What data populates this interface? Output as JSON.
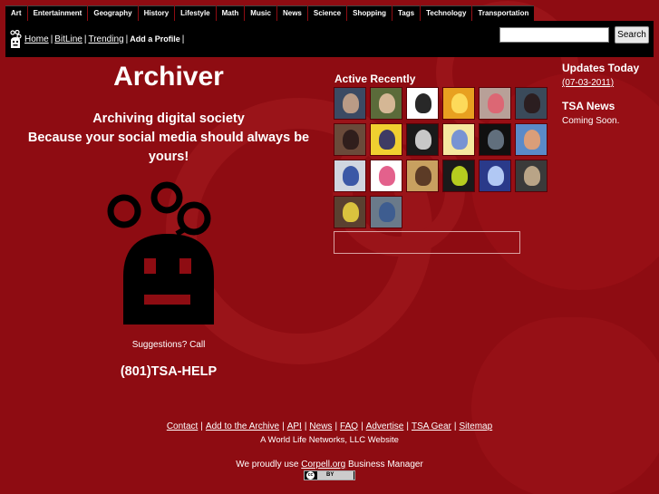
{
  "nav": {
    "categories": [
      "Art",
      "Entertainment",
      "Geography",
      "History",
      "Lifestyle",
      "Math",
      "Music",
      "News",
      "Science",
      "Shopping",
      "Tags",
      "Technology",
      "Transportation"
    ]
  },
  "topbar": {
    "home": "Home",
    "bitline": "BitLine",
    "trending": "Trending",
    "add_profile": "Add a Profile",
    "search_button": "Search",
    "search_value": ""
  },
  "main": {
    "title": "Archiver",
    "tagline_1": "Archiving digital society",
    "tagline_2": "Because your social media should always be yours!",
    "suggestions": "Suggestions? Call",
    "phone": "(801)TSA-HELP"
  },
  "active": {
    "heading": "Active Recently",
    "avatars": [
      {
        "bg": "#3b4a63",
        "fg": "#c9a48a"
      },
      {
        "bg": "#5b6b3a",
        "fg": "#e2c0a0"
      },
      {
        "bg": "#ffffff",
        "fg": "#111111"
      },
      {
        "bg": "#e8a020",
        "fg": "#ffe060"
      },
      {
        "bg": "#b8a098",
        "fg": "#e06070"
      },
      {
        "bg": "#3a4a5a",
        "fg": "#2a1a1a"
      },
      {
        "bg": "#6a4a3a",
        "fg": "#2a1a1a"
      },
      {
        "bg": "#f0d030",
        "fg": "#2a2a6a"
      },
      {
        "bg": "#1a1a1a",
        "fg": "#dcdcdc"
      },
      {
        "bg": "#f6e8a0",
        "fg": "#6a8ad8"
      },
      {
        "bg": "#101010",
        "fg": "#6a7a8a"
      },
      {
        "bg": "#5a8ac8",
        "fg": "#e8a070"
      },
      {
        "bg": "#d0d6e0",
        "fg": "#2a4aa0"
      },
      {
        "bg": "#ffffff",
        "fg": "#e05080"
      },
      {
        "bg": "#c8a060",
        "fg": "#503020"
      },
      {
        "bg": "#1a1a1a",
        "fg": "#c8e020"
      },
      {
        "bg": "#2a3a8a",
        "fg": "#c0d8ff"
      },
      {
        "bg": "#3a3a3a",
        "fg": "#c8b090"
      },
      {
        "bg": "#5a4030",
        "fg": "#e8d040"
      },
      {
        "bg": "#6a7a8a",
        "fg": "#3a5a90"
      }
    ]
  },
  "updates": {
    "heading": "Updates Today",
    "date": "(07-03-2011)",
    "news_heading": "TSA News",
    "news_text": "Coming Soon."
  },
  "footer": {
    "links": [
      "Contact",
      "Add to the Archive",
      "API",
      "News",
      "FAQ",
      "Advertise",
      "TSA Gear",
      "Sitemap"
    ],
    "company": "A World Life Networks, LLC Website",
    "proudly_prefix": "We proudly use",
    "proudly_link": "Corpell.org",
    "proudly_suffix": "Business Manager",
    "cc_label": "cc",
    "cc_text": "BY"
  },
  "colors": {
    "background": "#8e0c12",
    "bar": "#000000",
    "text": "#ffffff"
  }
}
